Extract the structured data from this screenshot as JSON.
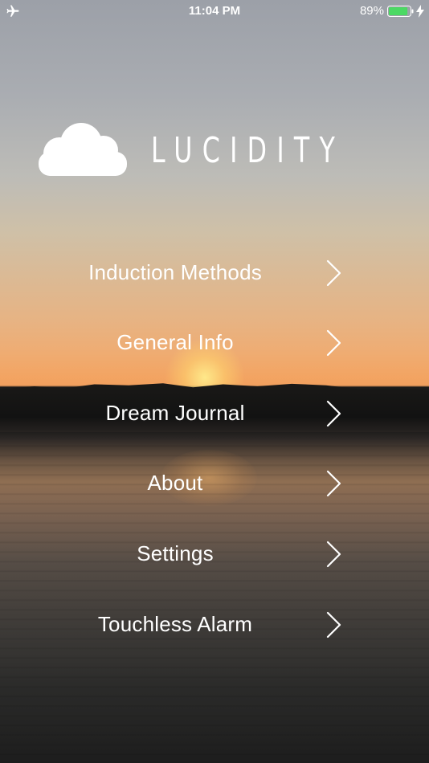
{
  "status_bar": {
    "time": "11:04 PM",
    "battery_percent": "89%",
    "battery_level": 0.89,
    "icons": [
      "airplane-icon",
      "battery-icon",
      "charging-bolt-icon"
    ]
  },
  "logo": {
    "title": "LUCIDITY",
    "icon": "cloud-icon"
  },
  "menu": {
    "items": [
      {
        "label": "Induction Methods",
        "icon": "chevron-right-icon"
      },
      {
        "label": "General Info",
        "icon": "chevron-right-icon"
      },
      {
        "label": "Dream Journal",
        "icon": "chevron-right-icon"
      },
      {
        "label": "About",
        "icon": "chevron-right-icon"
      },
      {
        "label": "Settings",
        "icon": "chevron-right-icon"
      },
      {
        "label": "Touchless Alarm",
        "icon": "chevron-right-icon"
      }
    ]
  },
  "colors": {
    "text": "#ffffff",
    "battery_fill": "#4cd964"
  }
}
